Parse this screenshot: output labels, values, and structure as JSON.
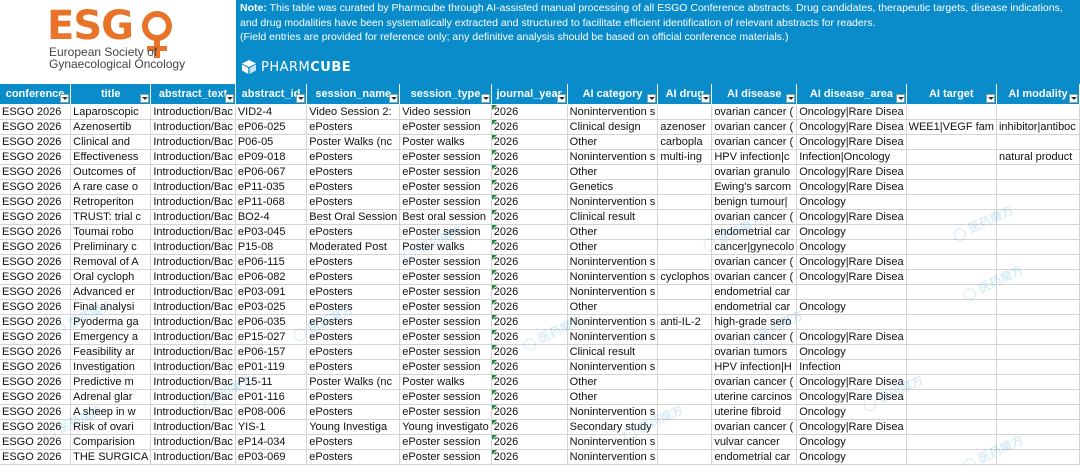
{
  "banner": {
    "esgo_letters": "ESG",
    "esgo_line1": "European Society of",
    "esgo_line2": "Gynaecological Oncology",
    "note_label": "Note:",
    "note_text": " This table was curated by Pharmcube through AI-assisted manual processing of all ESGO Conference abstracts. Drug candidates, therapeutic targets, disease indications, and drug modalities have been systematically extracted and structured to facilitate efficient identification of relevant abstracts for readers.",
    "note_sub": "(Field entries are provided for reference only; any definitive analysis should be based on official conference materials.)",
    "pharmcube_a": "PHARM",
    "pharmcube_b": "CUBE",
    "brand_color": "#0a8ccb",
    "esgo_color": "#e8742a"
  },
  "columns": [
    "conference",
    "title",
    "abstract_text",
    "abstract_id",
    "session_name",
    "session_type",
    "journal_year",
    "AI category",
    "AI drug",
    "AI disease",
    "AI disease_area",
    "AI target",
    "AI modality"
  ],
  "rows": [
    [
      "ESGO 2026",
      "Laparoscopic",
      "Introduction/Bac",
      "VID2-4",
      "Video Session 2:",
      "Video session",
      "2026",
      "Nonintervention s",
      "",
      "ovarian cancer (",
      "Oncology|Rare Disea",
      "",
      ""
    ],
    [
      "ESGO 2026",
      "Azenosertib",
      "Introduction/Bac",
      "eP06-025",
      "ePosters",
      "ePoster session",
      "2026",
      "Clinical design",
      "azenoser",
      "ovarian cancer (",
      "Oncology|Rare Disea",
      "WEE1|VEGF fam",
      "inhibitor|antiboc"
    ],
    [
      "ESGO 2026",
      "Clinical and",
      "Introduction/Bac",
      "P06-05",
      "Poster Walks (nc",
      "Poster walks",
      "2026",
      "Other",
      "carbopla",
      "ovarian cancer (",
      "Oncology|Rare Disea",
      "",
      ""
    ],
    [
      "ESGO 2026",
      "Effectiveness",
      "Introduction/Bac",
      "eP09-018",
      "ePosters",
      "ePoster session",
      "2026",
      "Nonintervention s",
      "multi-ing",
      "HPV infection|c",
      "Infection|Oncology",
      "",
      "natural product"
    ],
    [
      "ESGO 2026",
      "Outcomes of",
      "Introduction/Bac",
      "eP06-067",
      "ePosters",
      "ePoster session",
      "2026",
      "Other",
      "",
      "ovarian granulo",
      "Oncology|Rare Disea",
      "",
      ""
    ],
    [
      "ESGO 2026",
      "A rare case o",
      "Introduction/Bac",
      "eP11-035",
      "ePosters",
      "ePoster session",
      "2026",
      "Genetics",
      "",
      "Ewing's sarcom",
      "Oncology|Rare Disea",
      "",
      ""
    ],
    [
      "ESGO 2026",
      "Retroperiton",
      "Introduction/Bac",
      "eP11-068",
      "ePosters",
      "ePoster session",
      "2026",
      "Nonintervention s",
      "",
      "benign tumour|",
      "Oncology",
      "",
      ""
    ],
    [
      "ESGO 2026",
      "TRUST: trial c",
      "Introduction/Bac",
      "BO2-4",
      "Best Oral Session",
      "Best oral session",
      "2026",
      "Clinical result",
      "",
      "ovarian cancer (",
      "Oncology|Rare Disea",
      "",
      ""
    ],
    [
      "ESGO 2026",
      "Toumai robo",
      "Introduction/Bac",
      "eP03-045",
      "ePosters",
      "ePoster session",
      "2026",
      "Other",
      "",
      "endometrial car",
      "Oncology",
      "",
      ""
    ],
    [
      "ESGO 2026",
      "Preliminary c",
      "Introduction/Bac",
      "P15-08",
      "Moderated Post",
      "Poster walks",
      "2026",
      "Other",
      "",
      "cancer|gynecolo",
      "Oncology",
      "",
      ""
    ],
    [
      "ESGO 2026",
      "Removal of A",
      "Introduction/Bac",
      "eP06-115",
      "ePosters",
      "ePoster session",
      "2026",
      "Nonintervention s",
      "",
      "ovarian cancer (",
      "Oncology|Rare Disea",
      "",
      ""
    ],
    [
      "ESGO 2026",
      "Oral cycloph",
      "Introduction/Bac",
      "eP06-082",
      "ePosters",
      "ePoster session",
      "2026",
      "Nonintervention s",
      "cyclophos",
      "ovarian cancer (",
      "Oncology|Rare Disea",
      "",
      ""
    ],
    [
      "ESGO 2026",
      "Advanced er",
      "Introduction/Bac",
      "eP03-091",
      "ePosters",
      "ePoster session",
      "2026",
      "Nonintervention s",
      "",
      "endometrial car",
      "",
      "",
      ""
    ],
    [
      "ESGO 2026",
      "Final analysi",
      "Introduction/Bac",
      "eP03-025",
      "ePosters",
      "ePoster session",
      "2026",
      "Other",
      "",
      "endometrial car",
      "Oncology",
      "",
      ""
    ],
    [
      "ESGO 2026",
      "Pyoderma ga",
      "Introduction/Bac",
      "eP06-035",
      "ePosters",
      "ePoster session",
      "2026",
      "Nonintervention s",
      "anti-IL-2",
      "high-grade sero",
      "",
      "",
      ""
    ],
    [
      "ESGO 2026",
      "Emergency a",
      "Introduction/Bac",
      "eP15-027",
      "ePosters",
      "ePoster session",
      "2026",
      "Nonintervention s",
      "",
      "ovarian cancer (",
      "Oncology|Rare Disea",
      "",
      ""
    ],
    [
      "ESGO 2026",
      "Feasibility ar",
      "Introduction/Bac",
      "eP06-157",
      "ePosters",
      "ePoster session",
      "2026",
      "Clinical result",
      "",
      "ovarian tumors",
      "Oncology",
      "",
      ""
    ],
    [
      "ESGO 2026",
      "Investigation",
      "Introduction/Bac",
      "eP01-119",
      "ePosters",
      "ePoster session",
      "2026",
      "Nonintervention s",
      "",
      "HPV infection|H",
      "Infection",
      "",
      ""
    ],
    [
      "ESGO 2026",
      "Predictive m",
      "Introduction/Bac",
      "P15-11",
      "Poster Walks (nc",
      "Poster walks",
      "2026",
      "Other",
      "",
      "ovarian cancer (",
      "Oncology|Rare Disea",
      "",
      ""
    ],
    [
      "ESGO 2026",
      "Adrenal glar",
      "Introduction/Bac",
      "eP01-116",
      "ePosters",
      "ePoster session",
      "2026",
      "Other",
      "",
      "uterine carcinos",
      "Oncology|Rare Disea",
      "",
      ""
    ],
    [
      "ESGO 2026",
      "A sheep in w",
      "Introduction/Bac",
      "eP08-006",
      "ePosters",
      "ePoster session",
      "2026",
      "Nonintervention s",
      "",
      "uterine fibroid",
      "Oncology",
      "",
      ""
    ],
    [
      "ESGO 2026",
      "Risk of ovari",
      "Introduction/Bac",
      "YIS-1",
      "Young Investiga",
      "Young investigato",
      "2026",
      "Secondary study",
      "",
      "ovarian cancer (",
      "Oncology|Rare Disea",
      "",
      ""
    ],
    [
      "ESGO 2026",
      "Comparision",
      "Introduction/Bac",
      "eP14-034",
      "ePosters",
      "ePoster session",
      "2026",
      "Nonintervention s",
      "",
      "vulvar cancer",
      "Oncology",
      "",
      ""
    ],
    [
      "ESGO 2026",
      "THE SURGICA",
      "Introduction/Bac",
      "eP03-069",
      "ePosters",
      "ePoster session",
      "2026",
      "Nonintervention s",
      "",
      "endometrial car",
      "Oncology",
      "",
      ""
    ]
  ]
}
